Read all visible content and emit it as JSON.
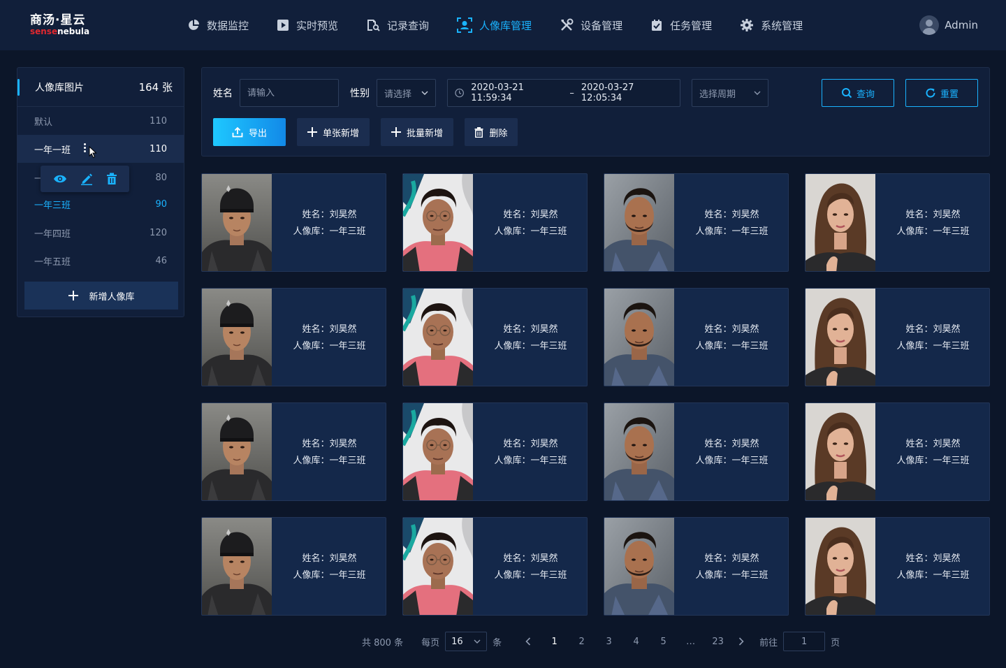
{
  "header": {
    "logo_zh": "商汤·星云",
    "logo_en_a": "sense",
    "logo_en_b": "nebula",
    "nav": [
      {
        "label": "数据监控",
        "icon": "pie-chart-icon"
      },
      {
        "label": "实时预览",
        "icon": "play-icon"
      },
      {
        "label": "记录查询",
        "icon": "search-doc-icon"
      },
      {
        "label": "人像库管理",
        "icon": "face-scan-icon",
        "active": true
      },
      {
        "label": "设备管理",
        "icon": "tools-icon"
      },
      {
        "label": "任务管理",
        "icon": "task-check-icon"
      },
      {
        "label": "系统管理",
        "icon": "gear-icon"
      }
    ],
    "user": "Admin"
  },
  "sidebar": {
    "title": "人像库图片",
    "total": "164 张",
    "items": [
      {
        "label": "默认",
        "count": "110"
      },
      {
        "label": "一年一班",
        "count": "110"
      },
      {
        "label": "一",
        "count": "80"
      },
      {
        "label": "一年三班",
        "count": "90"
      },
      {
        "label": "一年四班",
        "count": "120"
      },
      {
        "label": "一年五班",
        "count": "46"
      }
    ],
    "popup_actions": [
      "view-icon",
      "edit-icon",
      "delete-icon"
    ],
    "add_label": "新增人像库"
  },
  "filter": {
    "name_label": "姓名",
    "name_placeholder": "请输入",
    "gender_label": "性别",
    "gender_placeholder": "请选择",
    "date_start": "2020-03-21 11:59:34",
    "date_sep": "–",
    "date_end": "2020-03-27 12:05:34",
    "period_placeholder": "选择周期",
    "query": "查询",
    "reset": "重置",
    "export": "导出",
    "add_single": "单张新增",
    "add_batch": "批量新增",
    "delete": "删除"
  },
  "card": {
    "name_line": "姓名：刘昊然",
    "lib_line": "人像库：一年三班"
  },
  "colors": {
    "accent": "#1ab3ff",
    "bg": "#0c1629",
    "panel": "#111f3a",
    "card": "#14284a"
  },
  "pagination": {
    "total": "共 800 条",
    "per_page_label": "每页",
    "per_page": "16",
    "unit": "条",
    "pages": [
      "1",
      "2",
      "3",
      "4",
      "5",
      "…",
      "23"
    ],
    "current": "1",
    "goto_label": "前往",
    "goto_value": "1",
    "page_unit": "页"
  }
}
